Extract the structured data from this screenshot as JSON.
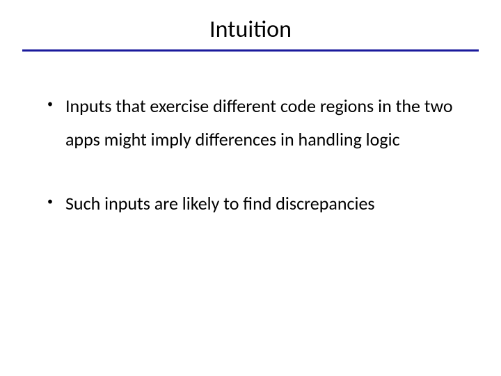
{
  "title": "Intuition",
  "bullets": [
    "Inputs that exercise different code regions in the two apps might imply differences in handling logic",
    "Such inputs are likely to find discrepancies"
  ],
  "colors": {
    "underline": "#1a1a9c",
    "text": "#000000",
    "background": "#ffffff"
  }
}
